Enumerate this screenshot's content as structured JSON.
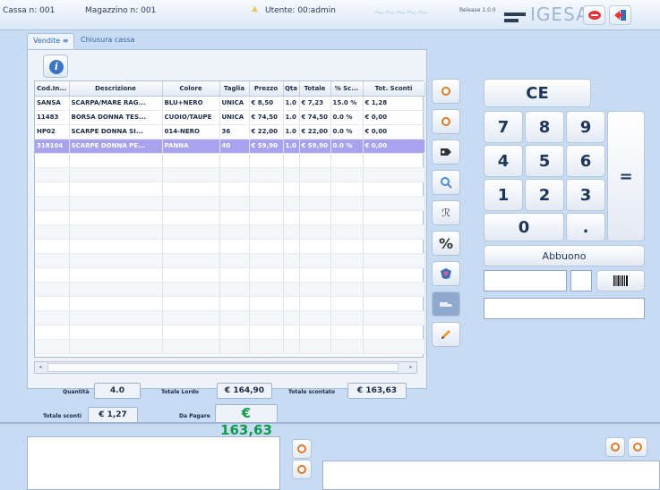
{
  "header": {
    "cassa": "Cassa n: 001",
    "magazzino": "Magazzino n: 001",
    "utente": "Utente: 00:admin",
    "release": "Release 1.0.0",
    "brand": "IGESA"
  },
  "tabs": [
    {
      "label": "Vendite ≡"
    },
    {
      "label": "Chiusura cassa"
    }
  ],
  "table": {
    "columns": [
      "Cod.In...",
      "Descrizione",
      "Colore",
      "Taglia",
      "Prezzo",
      "Qta",
      "Totale",
      "% Sc...",
      "Tot. Sconti"
    ],
    "rows": [
      [
        "SANSA",
        "SCARPA/MARE RAG...",
        "BLU+NERO",
        "UNICA",
        "€ 8,50",
        "1.0",
        "€ 7,23",
        "15.0 %",
        "€ 1,28"
      ],
      [
        "11483",
        "BORSA DONNA TES...",
        "CUOIO/TAUPE",
        "UNICA",
        "€ 74,50",
        "1.0",
        "€ 74,50",
        "0.0 %",
        "€ 0,00"
      ],
      [
        "HP02",
        "SCARPE DONNA SI...",
        "014-NERO",
        "36",
        "€ 22,00",
        "1.0",
        "€ 22,00",
        "0.0 %",
        "€ 0,00"
      ],
      [
        "318104",
        "SCARPE DONNA PE...",
        "PANNA",
        "40",
        "€ 59,90",
        "1.0",
        "€ 59,90",
        "0.0 %",
        "€ 0,00"
      ]
    ],
    "selected_row": 3
  },
  "totals": {
    "quantita_label": "Quantità",
    "quantita": "4.0",
    "totale_lordo_label": "Totale Lordo",
    "totale_lordo": "€ 164,90",
    "totale_scontato_label": "Totale scontato",
    "totale_scontato": "€ 163,63",
    "totale_sconti_label": "Totale sconti",
    "totale_sconti": "€ 1,27",
    "da_pagare_label": "Da Pagare",
    "da_pagare": "€ 163,63"
  },
  "keypad": {
    "ce": "CE",
    "digits": [
      "7",
      "8",
      "9",
      "4",
      "5",
      "6",
      "1",
      "2",
      "3",
      "0",
      "."
    ],
    "equals": "=",
    "abbuono": "Abbuono"
  },
  "colors": {
    "background": "#c7dbf2",
    "selected_row": "#a9a2ec",
    "da_pagare": "#0f9a4c",
    "accent_orange": "#e0792a"
  }
}
